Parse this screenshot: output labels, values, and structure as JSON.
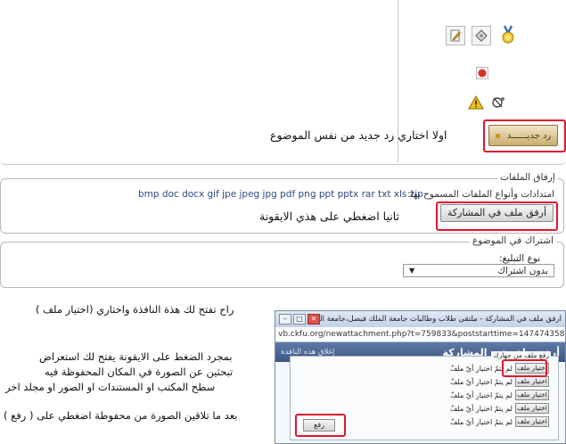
{
  "toolbar_icons": [
    "edit-note-icon",
    "diamond-tag-icon",
    "gold-medal-icon",
    "red-circle-icon",
    "warning-icon",
    "spam-report-icon"
  ],
  "quick_reply": {
    "button_label": "رد جديــــــد",
    "annotation": "اولا اختاري رد جديد من نفس الموضوع"
  },
  "attachments": {
    "legend": "إرفاق الملفات",
    "extensions_label": "امتدادات وأنواع الملفات المسموح بها:",
    "extensions_list": "bmp doc docx gif jpe jpeg jpg pdf png ppt pptx rar txt xls zip",
    "attach_button": "أرفق ملف في المشاركة",
    "annotation": "ثانيا اضغطي على هذي الايقونة"
  },
  "subscribe": {
    "legend": "اشتراك في الموضوع",
    "notify_label": "نوع التبليغ:",
    "selected_option": "بدون اشتراك"
  },
  "notes": {
    "window_opens": "راح تفتح لك هذة النافذة واختاري (اختيار ملف )",
    "browse_line1": "بمجرد الضغط على الايقونة يفتح لك استعراض",
    "browse_line2": "تبحثين عن الصورة في المكان المحفوظة فيه",
    "browse_line3": "سطح المكتب او المستندات او الصور او مجلد اخر",
    "upload_note": "بعد ما تلاقين الصورة من محفوظة اضغطي على ( رفع )"
  },
  "popup": {
    "window_title": "أرفق ملف في المشاركة - ملتقى طلاب وطالبات جامعة الملك فيصل،جامعة الدمام - Go...",
    "url": "vb.ckfu.org/newattachment.php?t=759833&poststarttime=1474743588",
    "header_title": "أرفق ملف في المشاركة",
    "close_link": "إغلاق هذه النافذة",
    "fieldset_legend": "رفع ملف من جهازك",
    "file_button_label": "اختيار ملف",
    "no_file_text": "لم يتمّ اختيار أيّ ملفّ",
    "upload_button": "رفع"
  }
}
